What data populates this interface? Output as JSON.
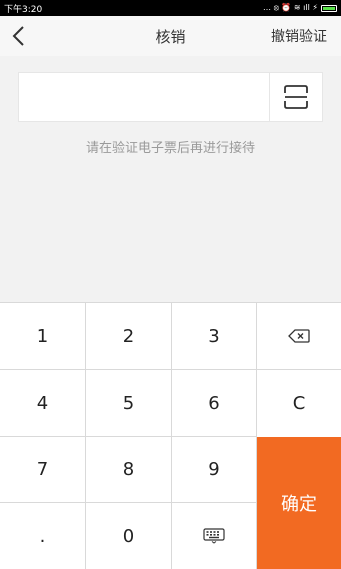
{
  "status_bar": {
    "time": "下午3:20",
    "icons": "… ⦻ ⏰ ≋ ıll ⚡"
  },
  "nav": {
    "back_icon": "chevron-left-icon",
    "title": "核销",
    "right_action": "撤销验证"
  },
  "input": {
    "value": "",
    "placeholder": "",
    "scan_icon": "scan-icon"
  },
  "hint": "请在验证电子票后再进行接待",
  "keypad": {
    "keys": [
      "1",
      "2",
      "3",
      "4",
      "5",
      "6",
      "7",
      "8",
      "9",
      ".",
      "0"
    ],
    "backspace_icon": "backspace-icon",
    "clear_label": "C",
    "keyboard_icon": "keyboard-icon",
    "confirm_label": "确定",
    "confirm_color": "#f26a22"
  }
}
